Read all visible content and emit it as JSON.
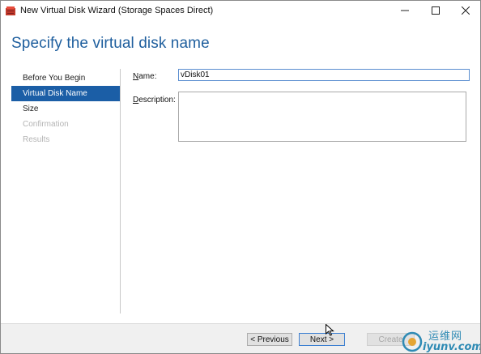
{
  "window": {
    "title": "New Virtual Disk Wizard (Storage Spaces Direct)"
  },
  "header": {
    "title": "Specify the virtual disk name"
  },
  "nav": {
    "items": [
      {
        "label": "Before You Begin",
        "state": "normal"
      },
      {
        "label": "Virtual Disk Name",
        "state": "active"
      },
      {
        "label": "Size",
        "state": "normal"
      },
      {
        "label": "Confirmation",
        "state": "disabled"
      },
      {
        "label": "Results",
        "state": "disabled"
      }
    ]
  },
  "form": {
    "name_label_accel": "N",
    "name_label_rest": "ame:",
    "name_value": "vDisk01",
    "description_label_accel": "D",
    "description_label_rest": "escription:",
    "description_value": ""
  },
  "footer": {
    "previous_label": "< Previous",
    "next_label": "Next >",
    "create_label": "Create"
  },
  "watermark": {
    "top_text": "运维网",
    "bottom_text": "iyunv.com"
  },
  "colors": {
    "accent": "#1b5ea6",
    "title_blue": "#1f5f9e",
    "disabled_text": "#b4b4b4",
    "footer_bg": "#f0f0f0"
  },
  "icons": {
    "app": "storage-wizard-icon",
    "minimize": "minimize-icon",
    "maximize": "maximize-icon",
    "close": "close-icon",
    "cursor": "mouse-pointer-icon"
  }
}
